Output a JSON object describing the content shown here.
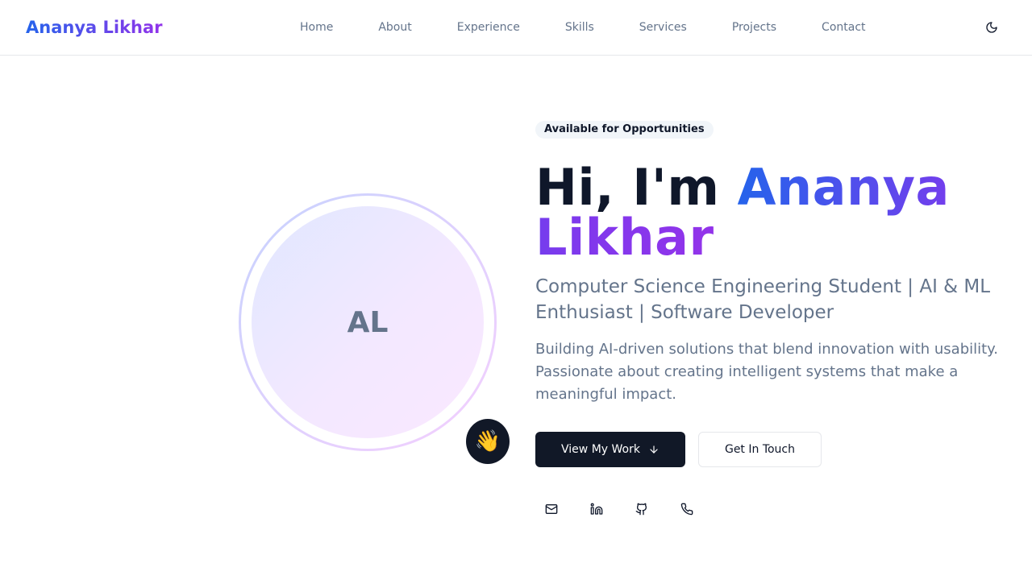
{
  "header": {
    "brand": "Ananya Likhar",
    "nav": [
      "Home",
      "About",
      "Experience",
      "Skills",
      "Services",
      "Projects",
      "Contact"
    ],
    "theme_toggle_icon": "moon-icon"
  },
  "hero": {
    "badge": "Available for Opportunities",
    "greeting": "Hi, I'm ",
    "name": "Ananya Likhar",
    "tagline": "Computer Science Engineering Student | AI & ML Enthusiast | Software Developer",
    "description": "Building AI-driven solutions that blend innovation with usability. Passionate about creating intelligent systems that make a meaningful impact.",
    "avatar_initials": "AL",
    "wave_emoji": "👋",
    "primary_button": "View My Work",
    "primary_button_icon": "arrow-down-icon",
    "secondary_button": "Get In Touch",
    "socials": [
      "mail-icon",
      "linkedin-icon",
      "github-icon",
      "phone-icon"
    ]
  },
  "colors": {
    "gradient_start": "#2563eb",
    "gradient_end": "#9333ea",
    "primary_button_bg": "#111827",
    "muted_text": "#64748b"
  }
}
